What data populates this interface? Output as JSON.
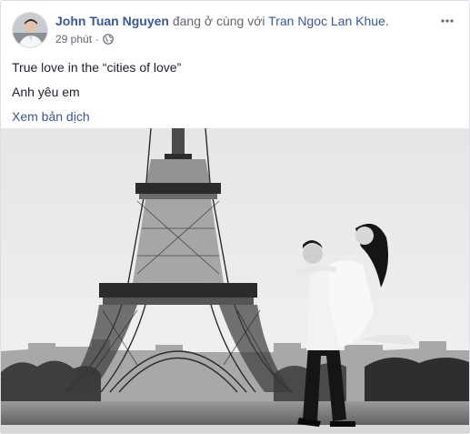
{
  "post": {
    "author": "John Tuan Nguyen",
    "with_text": "đang ở cùng với",
    "tagged_person": "Tran Ngoc Lan Khue",
    "timestamp": "29 phút",
    "privacy_icon": "globe-icon",
    "more_icon": "more-horizontal-icon",
    "lines": [
      "True love in the “cities of love”",
      "Anh yêu em"
    ],
    "translate_link": "Xem bản dịch",
    "photo_description": "black-and-white photo of couple in front of Eiffel Tower"
  },
  "colors": {
    "link": "#385898",
    "muted": "#616770",
    "text": "#1d2129"
  }
}
